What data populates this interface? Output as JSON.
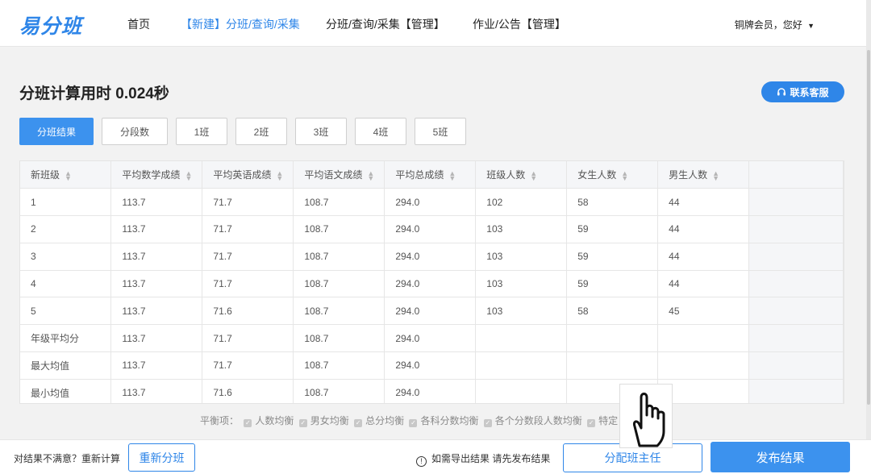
{
  "header": {
    "logo": "易分班",
    "nav": [
      "首页",
      "【新建】分班/查询/采集",
      "分班/查询/采集【管理】",
      "作业/公告【管理】"
    ],
    "user": "铜牌会员，您好"
  },
  "page": {
    "title": "分班计算用时 0.024秒",
    "service_label": "联系客服"
  },
  "tabs": [
    "分班结果",
    "分段数",
    "1班",
    "2班",
    "3班",
    "4班",
    "5班"
  ],
  "table": {
    "columns": [
      "新班级",
      "平均数学成绩",
      "平均英语成绩",
      "平均语文成绩",
      "平均总成绩",
      "班级人数",
      "女生人数",
      "男生人数"
    ],
    "rows": [
      [
        "1",
        "113.7",
        "71.7",
        "108.7",
        "294.0",
        "102",
        "58",
        "44"
      ],
      [
        "2",
        "113.7",
        "71.7",
        "108.7",
        "294.0",
        "103",
        "59",
        "44"
      ],
      [
        "3",
        "113.7",
        "71.7",
        "108.7",
        "294.0",
        "103",
        "59",
        "44"
      ],
      [
        "4",
        "113.7",
        "71.7",
        "108.7",
        "294.0",
        "103",
        "59",
        "44"
      ],
      [
        "5",
        "113.7",
        "71.6",
        "108.7",
        "294.0",
        "103",
        "58",
        "45"
      ],
      [
        "年级平均分",
        "113.7",
        "71.7",
        "108.7",
        "294.0",
        "",
        "",
        ""
      ],
      [
        "最大均值",
        "113.7",
        "71.7",
        "108.7",
        "294.0",
        "",
        "",
        ""
      ],
      [
        "最小均值",
        "113.7",
        "71.6",
        "108.7",
        "294.0",
        "",
        "",
        ""
      ]
    ]
  },
  "balance": {
    "label": "平衡项：",
    "items": [
      "人数均衡",
      "男女均衡",
      "总分均衡",
      "各科分数均衡",
      "各个分数段人数均衡",
      "特定"
    ]
  },
  "footer": {
    "unsatisfied": "对结果不满意？重新计算",
    "redo_label": "重新分班",
    "export_note": "如需导出结果 请先发布结果",
    "assign_label": "分配班主任",
    "publish_label": "发布结果"
  }
}
